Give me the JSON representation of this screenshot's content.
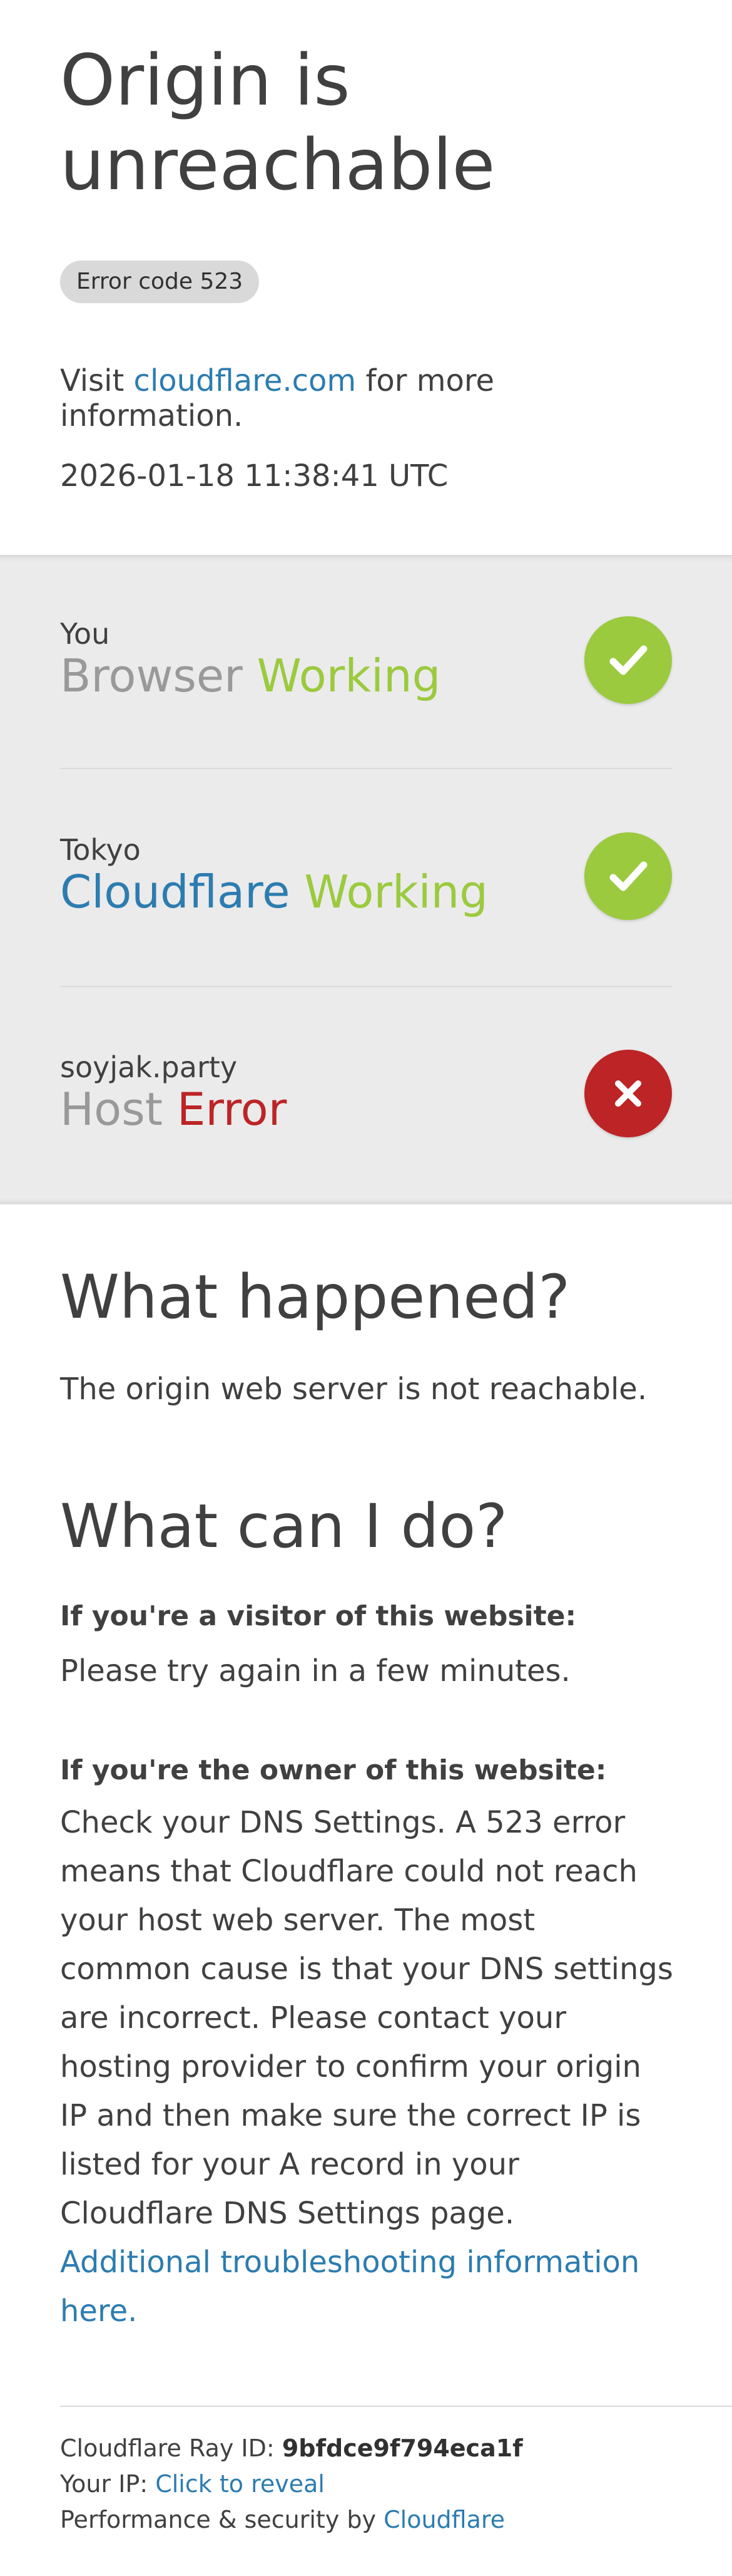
{
  "header": {
    "title": "Origin is unreachable",
    "error_code": "Error code 523",
    "visit_prefix": "Visit",
    "visit_link": "cloudflare.com",
    "visit_suffix": "for more information.",
    "timestamp": "2026-01-18 11:38:41 UTC"
  },
  "status": {
    "items": [
      {
        "location": "You",
        "name": "Browser",
        "state": "Working",
        "result": "ok"
      },
      {
        "location": "Tokyo",
        "name": "Cloudflare",
        "state": "Working",
        "result": "ok"
      },
      {
        "location": "soyjak.party",
        "name": "Host",
        "state": "Error",
        "result": "error"
      }
    ],
    "colors": {
      "ok": "#9bca3e",
      "error": "#bd2426",
      "link": "#2c7cb0"
    },
    "icons": [
      "checkmark-icon",
      "checkmark-icon",
      "cross-icon"
    ]
  },
  "what_happened": {
    "heading": "What happened?",
    "text": "The origin web server is not reachable."
  },
  "what_can_i_do": {
    "heading": "What can I do?",
    "visitor_heading": "If you're a visitor of this website:",
    "visitor_text": "Please try again in a few minutes.",
    "owner_heading": "If you're the owner of this website:",
    "owner_text": "Check your DNS Settings. A 523 error means that Cloudflare could not reach your host web server. The most common cause is that your DNS settings are incorrect. Please contact your hosting provider to confirm your origin IP and then make sure the correct IP is listed for your A record in your Cloudflare DNS Settings page.",
    "owner_link": "Additional troubleshooting information here."
  },
  "footer": {
    "ray_label": "Cloudflare Ray ID:",
    "ray_id": "9bfdce9f794eca1f",
    "ip_label": "Your IP:",
    "ip_link": "Click to reveal",
    "perf_label": "Performance & security by",
    "perf_link": "Cloudflare"
  }
}
